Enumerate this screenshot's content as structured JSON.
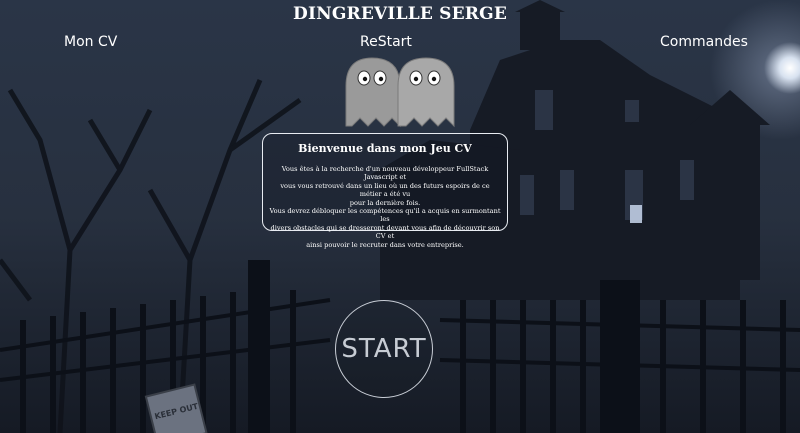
{
  "header": {
    "title": "DINGREVILLE SERGE"
  },
  "nav": {
    "cv": "Mon CV",
    "restart": "ReStart",
    "commands": "Commandes"
  },
  "intro": {
    "title": "Bienvenue dans mon Jeu CV",
    "lines": [
      "Vous êtes à la recherche d'un nouveau développeur FullStack Javascript et",
      "vous vous retrouvé dans un lieu où un des futurs espoirs de ce métier a été vu",
      "pour la dernière fois.",
      "Vous devrez débloquer les compétences qu'il a acquis en surmontant les",
      "divers obstacles qui se dresseront devant vous afin de découvrir son CV et",
      "ainsi pouvoir le recruter dans votre entreprise."
    ]
  },
  "start": {
    "label": "START"
  },
  "sign": {
    "text": "KEEP OUT"
  },
  "colors": {
    "text": "#ffffff",
    "start_text": "#c7ccd4",
    "box_border": "#e8ecf2",
    "ghost": "#9a9a9a"
  }
}
